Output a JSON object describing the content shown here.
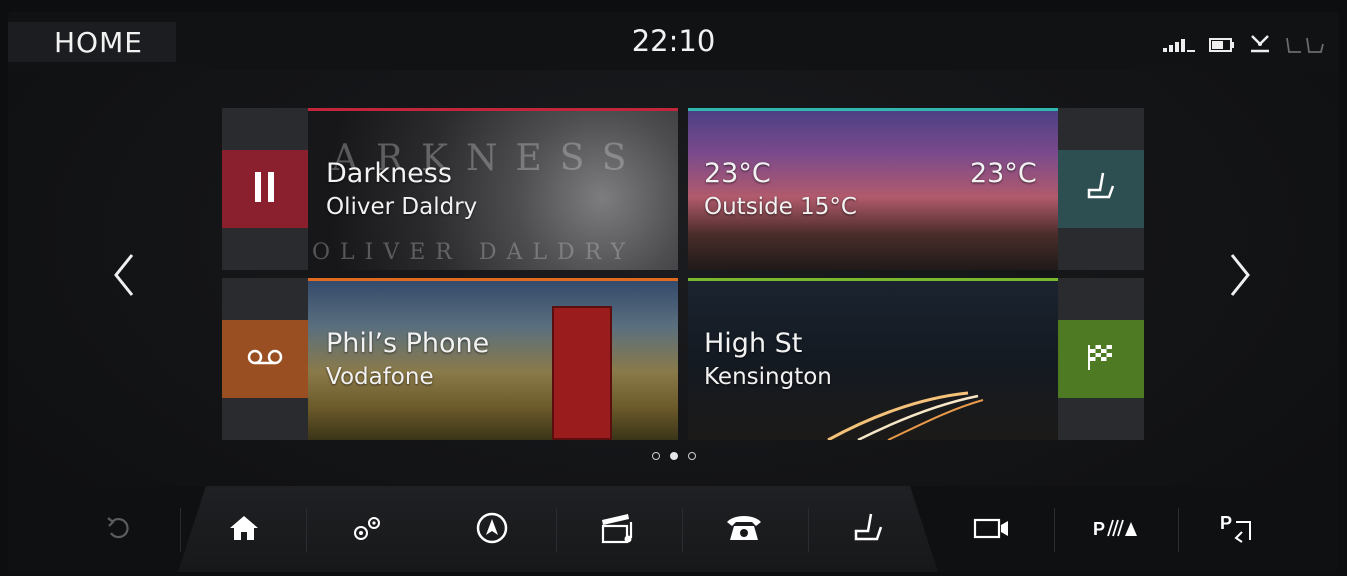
{
  "status": {
    "home_label": "HOME",
    "time": "22:10",
    "icons": [
      "signal-icon",
      "battery-icon",
      "seatbelt-warning-icon",
      "seat-occupancy-icon"
    ]
  },
  "navigation": {
    "prev_icon": "chevron-left-icon",
    "next_icon": "chevron-right-icon",
    "page_count": 3,
    "active_page": 2
  },
  "tiles": {
    "media": {
      "title": "Darkness",
      "subtitle": "Oliver Daldry",
      "button_icon": "pause-icon",
      "accent": "#c2263a",
      "button_color": "#8a1f2e",
      "art_text_top": "ARKNESS",
      "art_text_bottom": "OLIVER DALDRY"
    },
    "climate": {
      "temp_left": "23°C",
      "temp_right": "23°C",
      "outside": "Outside 15°C",
      "button_icon": "seat-icon",
      "accent": "#2fb7b0",
      "button_color": "#2e4f52"
    },
    "phone": {
      "title": "Phil’s Phone",
      "subtitle": "Vodafone",
      "button_icon": "voicemail-icon",
      "accent": "#e06a1f",
      "button_color": "#9a4f22"
    },
    "navigation": {
      "title": "High St",
      "subtitle": "Kensington",
      "button_icon": "checkered-flag-icon",
      "accent": "#7ab82e",
      "button_color": "#4f7a24"
    }
  },
  "bottom_bar": {
    "items": [
      "back-icon",
      "home-icon",
      "settings-icon",
      "navigation-icon",
      "media-icon",
      "phone-icon",
      "seat-icon",
      "camera-icon",
      "park-assist-icon",
      "park-exit-icon"
    ]
  }
}
